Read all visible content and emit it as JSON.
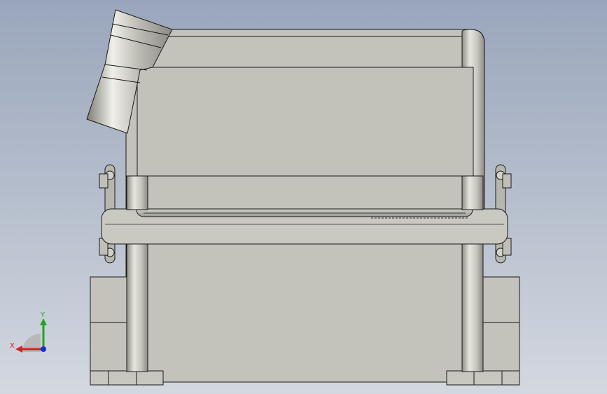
{
  "triad": {
    "x_label": "X",
    "y_label": "Y",
    "x_color": "#d42020",
    "y_color": "#1fa51f",
    "z_color": "#1e2ad0"
  },
  "colors": {
    "body": "#c3c3bb",
    "body_light": "#d8d8d0",
    "body_dark": "#9e9e96",
    "edge": "#1a1a1a"
  }
}
